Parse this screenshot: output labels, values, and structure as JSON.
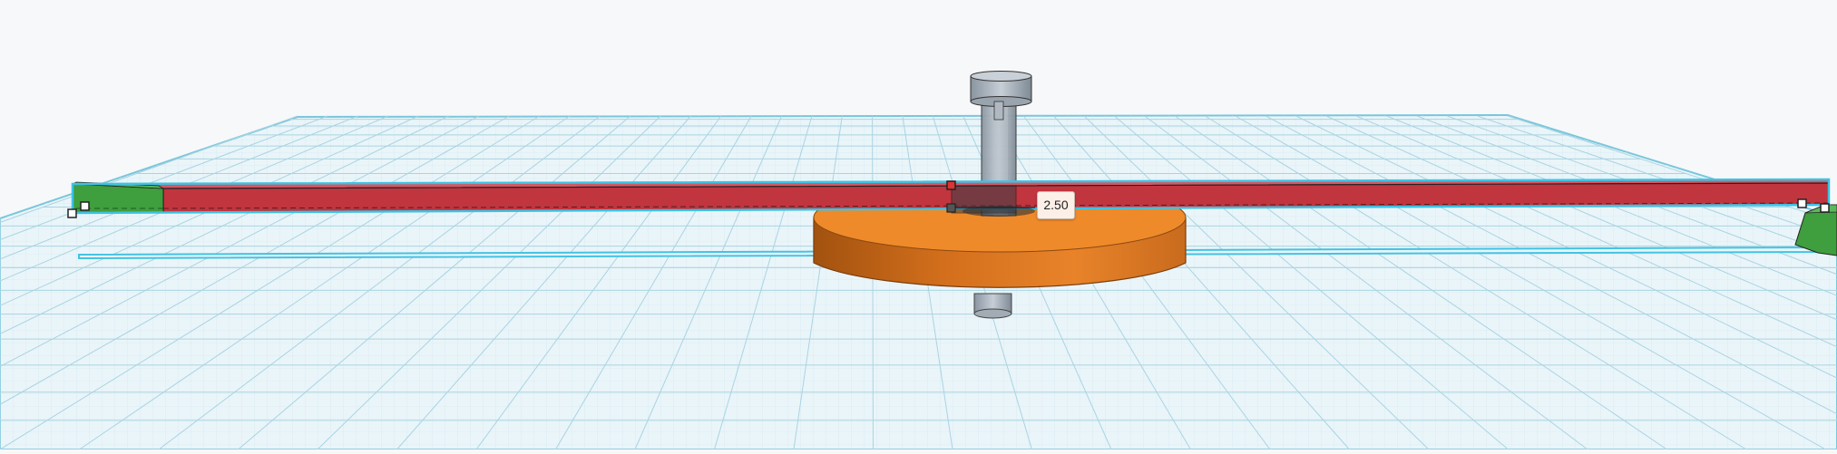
{
  "workplane": {
    "grid_color": "#9fcfe0",
    "plane_color": "#e8f4f8",
    "selection_outline_color": "#3fc0e0"
  },
  "objects": {
    "red_bar": {
      "color": "#c1353f"
    },
    "green_end_left": {
      "color": "#3f9e3d"
    },
    "green_end_right": {
      "color": "#3f9e3d"
    },
    "orange_disc": {
      "color": "#e57f22"
    },
    "axle": {
      "color": "#9aa6b1"
    }
  },
  "dimension_tooltip": {
    "value": "2.50"
  }
}
